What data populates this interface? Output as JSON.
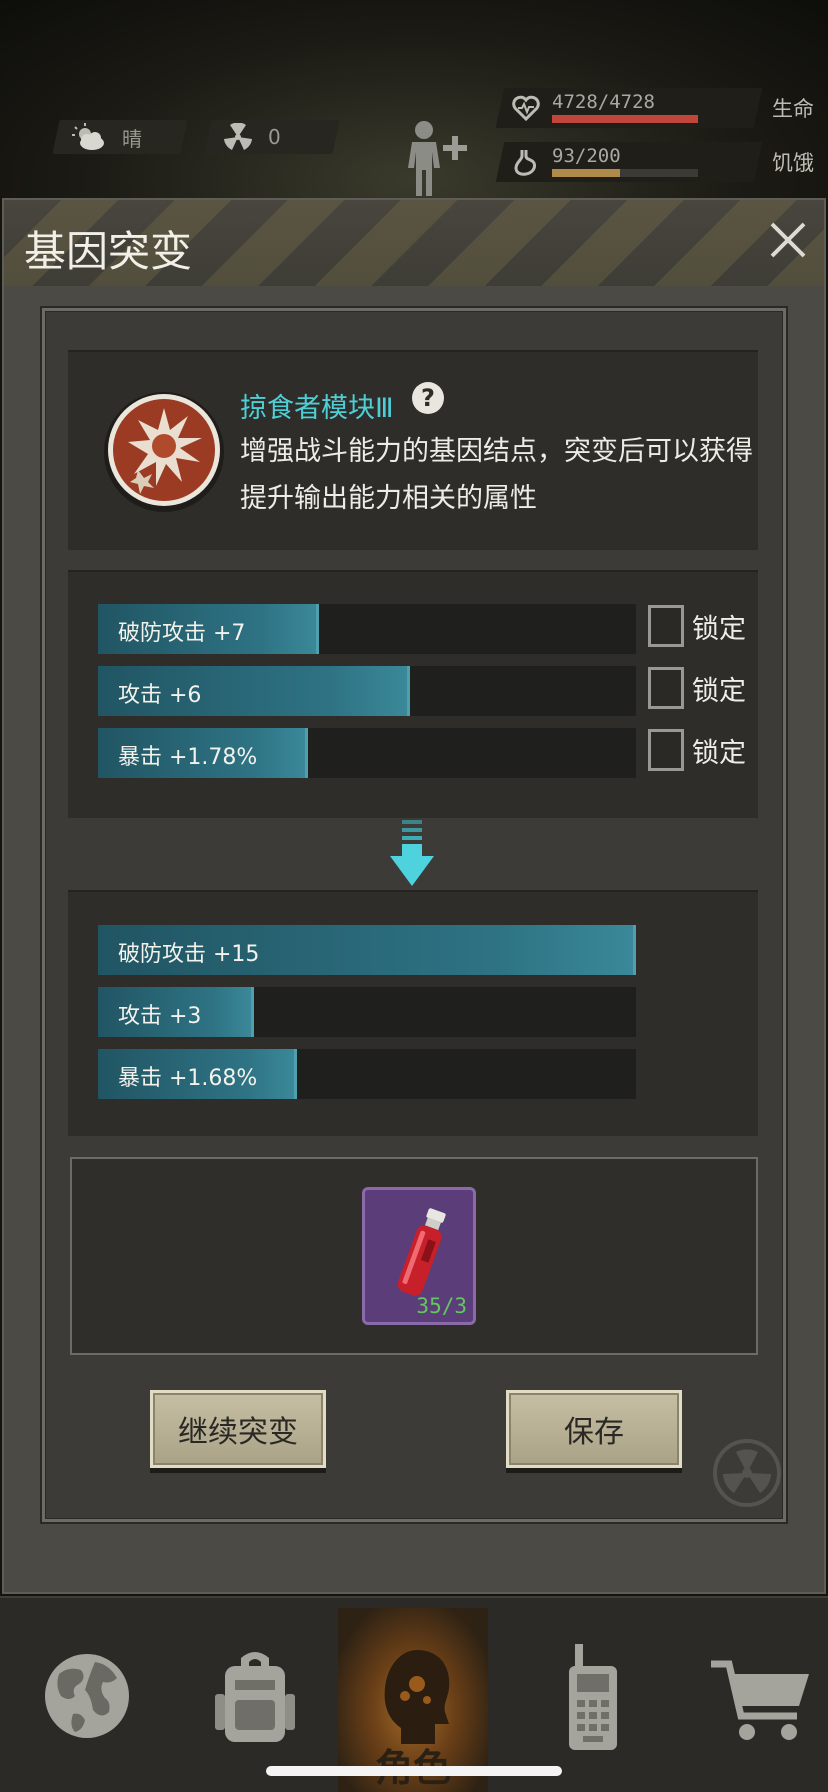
{
  "status": {
    "weather_label": "晴",
    "radiation_value": "0",
    "health": {
      "value": "4728/4728",
      "label": "生命",
      "fill": 1.0,
      "color": "#c0453a"
    },
    "hunger": {
      "value": "93/200",
      "label": "饥饿",
      "fill": 0.465,
      "color": "#b08a4a"
    }
  },
  "panel": {
    "title": "基因突变",
    "module_name": "掠食者模块Ⅲ",
    "description": "增强战斗能力的基因结点，突变后可以获得提升输出能力相关的属性",
    "current_stats": [
      {
        "label": "破防攻击 +7",
        "fill": 0.41,
        "lock_label": "锁定"
      },
      {
        "label": "攻击 +6",
        "fill": 0.58,
        "lock_label": "锁定"
      },
      {
        "label": "暴击 +1.78%",
        "fill": 0.39,
        "lock_label": "锁定"
      }
    ],
    "new_stats": [
      {
        "label": "破防攻击 +15",
        "fill": 1.0
      },
      {
        "label": "攻击 +3",
        "fill": 0.29
      },
      {
        "label": "暴击 +1.68%",
        "fill": 0.37
      }
    ],
    "item": {
      "count": "35/3",
      "icon": "red-vial-icon"
    },
    "continue_label": "继续突变",
    "save_label": "保存"
  },
  "nav": {
    "items": [
      {
        "icon": "globe-icon"
      },
      {
        "icon": "backpack-icon"
      },
      {
        "icon": "character-icon",
        "label": "角色",
        "active": true
      },
      {
        "icon": "walkie-talkie-icon"
      },
      {
        "icon": "cart-icon"
      }
    ]
  },
  "colors": {
    "accent_cyan": "#4ecfd6",
    "bar_teal": "#2e7384",
    "item_purple": "#5b3d79"
  }
}
